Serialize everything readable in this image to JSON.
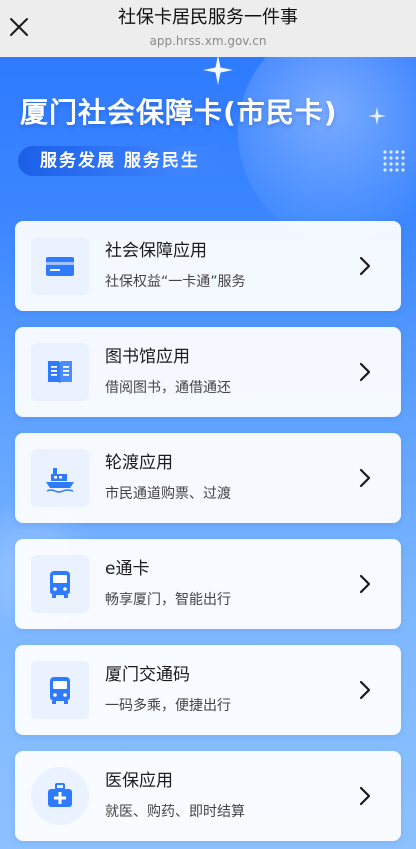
{
  "topbar": {
    "title": "社保卡居民服务一件事",
    "url": "app.hrss.xm.gov.cn"
  },
  "hero": {
    "title": "厦门社会保障卡(市民卡)",
    "slogan": "服务发展 服务民生"
  },
  "colors": {
    "accent": "#2f7bff",
    "icon": "#2f7bff",
    "card_bg": "#ffffff"
  },
  "cards": [
    {
      "title": "社会保障应用",
      "subtitle": "社保权益“一卡通”服务",
      "icon": "bank-card-icon"
    },
    {
      "title": "图书馆应用",
      "subtitle": "借阅图书，通借通还",
      "icon": "book-icon"
    },
    {
      "title": "轮渡应用",
      "subtitle": "市民通道购票、过渡",
      "icon": "ferry-icon"
    },
    {
      "title": "e通卡",
      "subtitle": "畅享厦门，智能出行",
      "icon": "bus-icon"
    },
    {
      "title": "厦门交通码",
      "subtitle": "一码多乘，便捷出行",
      "icon": "bus-icon"
    },
    {
      "title": "医保应用",
      "subtitle": "就医、购药、即时结算",
      "icon": "medical-kit-icon"
    }
  ]
}
